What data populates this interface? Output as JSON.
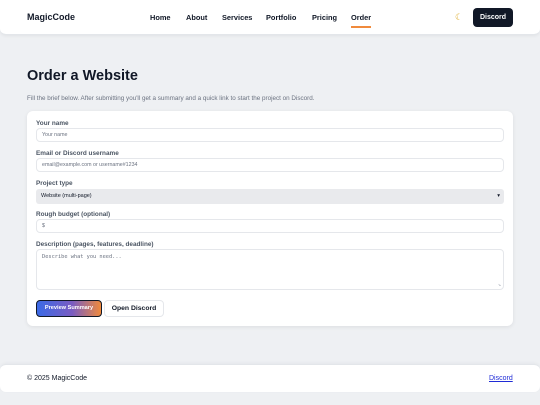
{
  "header": {
    "brand": "MagicCode",
    "nav": [
      {
        "label": "Home",
        "active": false
      },
      {
        "label": "About",
        "active": false
      },
      {
        "label": "Services",
        "active": false
      },
      {
        "label": "Portfolio",
        "active": false
      },
      {
        "label": "Pricing",
        "active": false
      },
      {
        "label": "Order",
        "active": true
      }
    ],
    "theme_icon": "moon-icon",
    "cta_label": "Discord"
  },
  "main": {
    "title": "Order a Website",
    "intro": "Fill the brief below. After submitting you'll get a summary and a quick link to start the project on Discord.",
    "form": {
      "name_label": "Your name",
      "name_placeholder": "Your name",
      "contact_label": "Email or Discord username",
      "contact_placeholder": "email@example.com or username#1234",
      "project_type_label": "Project type",
      "project_type_value": "Website (multi-page)",
      "budget_label": "Rough budget (optional)",
      "budget_placeholder": "$",
      "description_label": "Description (pages, features, deadline)",
      "description_placeholder": "Describe what you need...",
      "preview_button": "Preview Summary",
      "discord_button": "Open Discord"
    }
  },
  "footer": {
    "copyright": "© 2025 MagicCode",
    "link": "Discord"
  },
  "colors": {
    "accent_orange": "#f08a3c",
    "accent_blue": "#3b6ae6",
    "dark": "#111827",
    "background": "#eef0f3"
  }
}
